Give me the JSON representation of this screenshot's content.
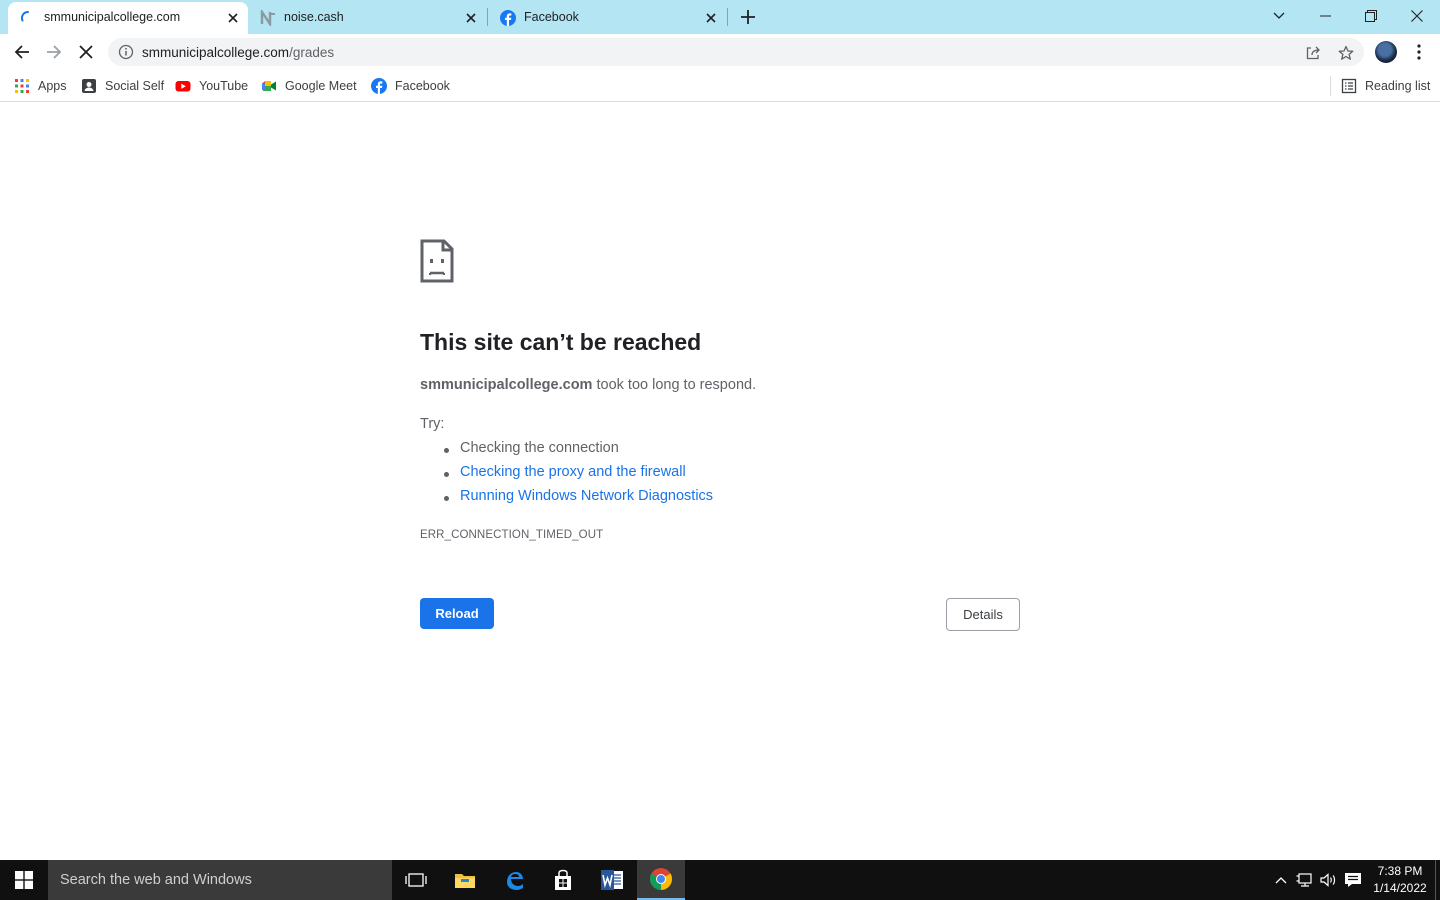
{
  "browser": {
    "tabs": [
      {
        "title": "smmunicipalcollege.com",
        "active": true,
        "favicon": "loading-spinner-icon"
      },
      {
        "title": "noise.cash",
        "active": false,
        "favicon": "noise-cash-icon"
      },
      {
        "title": "Facebook",
        "active": false,
        "favicon": "facebook-icon"
      }
    ],
    "address": {
      "host": "smmunicipalcollege.com",
      "path": "/grades"
    },
    "bookmarks": [
      {
        "label": "Apps",
        "icon": "apps-grid-icon"
      },
      {
        "label": "Social Self",
        "icon": "social-self-icon"
      },
      {
        "label": "YouTube",
        "icon": "youtube-icon"
      },
      {
        "label": "Google Meet",
        "icon": "google-meet-icon"
      },
      {
        "label": "Facebook",
        "icon": "facebook-icon"
      }
    ],
    "reading_list": "Reading list"
  },
  "error_page": {
    "title": "This site can’t be reached",
    "host": "smmunicipalcollege.com",
    "message": "took too long to respond.",
    "try_label": "Try:",
    "suggestions": [
      {
        "text": "Checking the connection",
        "link": false
      },
      {
        "text": "Checking the proxy and the firewall",
        "link": true
      },
      {
        "text": "Running Windows Network Diagnostics",
        "link": true
      }
    ],
    "error_code": "ERR_CONNECTION_TIMED_OUT",
    "reload_label": "Reload",
    "details_label": "Details"
  },
  "taskbar": {
    "search_placeholder": "Search the web and Windows",
    "time": "7:38 PM",
    "date": "1/14/2022"
  },
  "colors": {
    "tab_strip": "#b3e5f2",
    "accent_blue": "#1a73e8",
    "taskbar": "#101010"
  }
}
